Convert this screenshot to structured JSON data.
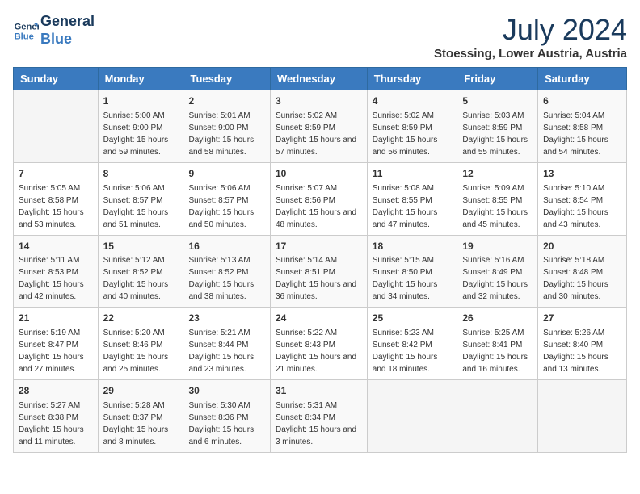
{
  "header": {
    "logo_line1": "General",
    "logo_line2": "Blue",
    "month_year": "July 2024",
    "location": "Stoessing, Lower Austria, Austria"
  },
  "weekdays": [
    "Sunday",
    "Monday",
    "Tuesday",
    "Wednesday",
    "Thursday",
    "Friday",
    "Saturday"
  ],
  "weeks": [
    [
      {
        "day": "",
        "sunrise": "",
        "sunset": "",
        "daylight": ""
      },
      {
        "day": "1",
        "sunrise": "5:00 AM",
        "sunset": "9:00 PM",
        "daylight": "15 hours and 59 minutes."
      },
      {
        "day": "2",
        "sunrise": "5:01 AM",
        "sunset": "9:00 PM",
        "daylight": "15 hours and 58 minutes."
      },
      {
        "day": "3",
        "sunrise": "5:02 AM",
        "sunset": "8:59 PM",
        "daylight": "15 hours and 57 minutes."
      },
      {
        "day": "4",
        "sunrise": "5:02 AM",
        "sunset": "8:59 PM",
        "daylight": "15 hours and 56 minutes."
      },
      {
        "day": "5",
        "sunrise": "5:03 AM",
        "sunset": "8:59 PM",
        "daylight": "15 hours and 55 minutes."
      },
      {
        "day": "6",
        "sunrise": "5:04 AM",
        "sunset": "8:58 PM",
        "daylight": "15 hours and 54 minutes."
      }
    ],
    [
      {
        "day": "7",
        "sunrise": "5:05 AM",
        "sunset": "8:58 PM",
        "daylight": "15 hours and 53 minutes."
      },
      {
        "day": "8",
        "sunrise": "5:06 AM",
        "sunset": "8:57 PM",
        "daylight": "15 hours and 51 minutes."
      },
      {
        "day": "9",
        "sunrise": "5:06 AM",
        "sunset": "8:57 PM",
        "daylight": "15 hours and 50 minutes."
      },
      {
        "day": "10",
        "sunrise": "5:07 AM",
        "sunset": "8:56 PM",
        "daylight": "15 hours and 48 minutes."
      },
      {
        "day": "11",
        "sunrise": "5:08 AM",
        "sunset": "8:55 PM",
        "daylight": "15 hours and 47 minutes."
      },
      {
        "day": "12",
        "sunrise": "5:09 AM",
        "sunset": "8:55 PM",
        "daylight": "15 hours and 45 minutes."
      },
      {
        "day": "13",
        "sunrise": "5:10 AM",
        "sunset": "8:54 PM",
        "daylight": "15 hours and 43 minutes."
      }
    ],
    [
      {
        "day": "14",
        "sunrise": "5:11 AM",
        "sunset": "8:53 PM",
        "daylight": "15 hours and 42 minutes."
      },
      {
        "day": "15",
        "sunrise": "5:12 AM",
        "sunset": "8:52 PM",
        "daylight": "15 hours and 40 minutes."
      },
      {
        "day": "16",
        "sunrise": "5:13 AM",
        "sunset": "8:52 PM",
        "daylight": "15 hours and 38 minutes."
      },
      {
        "day": "17",
        "sunrise": "5:14 AM",
        "sunset": "8:51 PM",
        "daylight": "15 hours and 36 minutes."
      },
      {
        "day": "18",
        "sunrise": "5:15 AM",
        "sunset": "8:50 PM",
        "daylight": "15 hours and 34 minutes."
      },
      {
        "day": "19",
        "sunrise": "5:16 AM",
        "sunset": "8:49 PM",
        "daylight": "15 hours and 32 minutes."
      },
      {
        "day": "20",
        "sunrise": "5:18 AM",
        "sunset": "8:48 PM",
        "daylight": "15 hours and 30 minutes."
      }
    ],
    [
      {
        "day": "21",
        "sunrise": "5:19 AM",
        "sunset": "8:47 PM",
        "daylight": "15 hours and 27 minutes."
      },
      {
        "day": "22",
        "sunrise": "5:20 AM",
        "sunset": "8:46 PM",
        "daylight": "15 hours and 25 minutes."
      },
      {
        "day": "23",
        "sunrise": "5:21 AM",
        "sunset": "8:44 PM",
        "daylight": "15 hours and 23 minutes."
      },
      {
        "day": "24",
        "sunrise": "5:22 AM",
        "sunset": "8:43 PM",
        "daylight": "15 hours and 21 minutes."
      },
      {
        "day": "25",
        "sunrise": "5:23 AM",
        "sunset": "8:42 PM",
        "daylight": "15 hours and 18 minutes."
      },
      {
        "day": "26",
        "sunrise": "5:25 AM",
        "sunset": "8:41 PM",
        "daylight": "15 hours and 16 minutes."
      },
      {
        "day": "27",
        "sunrise": "5:26 AM",
        "sunset": "8:40 PM",
        "daylight": "15 hours and 13 minutes."
      }
    ],
    [
      {
        "day": "28",
        "sunrise": "5:27 AM",
        "sunset": "8:38 PM",
        "daylight": "15 hours and 11 minutes."
      },
      {
        "day": "29",
        "sunrise": "5:28 AM",
        "sunset": "8:37 PM",
        "daylight": "15 hours and 8 minutes."
      },
      {
        "day": "30",
        "sunrise": "5:30 AM",
        "sunset": "8:36 PM",
        "daylight": "15 hours and 6 minutes."
      },
      {
        "day": "31",
        "sunrise": "5:31 AM",
        "sunset": "8:34 PM",
        "daylight": "15 hours and 3 minutes."
      },
      {
        "day": "",
        "sunrise": "",
        "sunset": "",
        "daylight": ""
      },
      {
        "day": "",
        "sunrise": "",
        "sunset": "",
        "daylight": ""
      },
      {
        "day": "",
        "sunrise": "",
        "sunset": "",
        "daylight": ""
      }
    ]
  ]
}
